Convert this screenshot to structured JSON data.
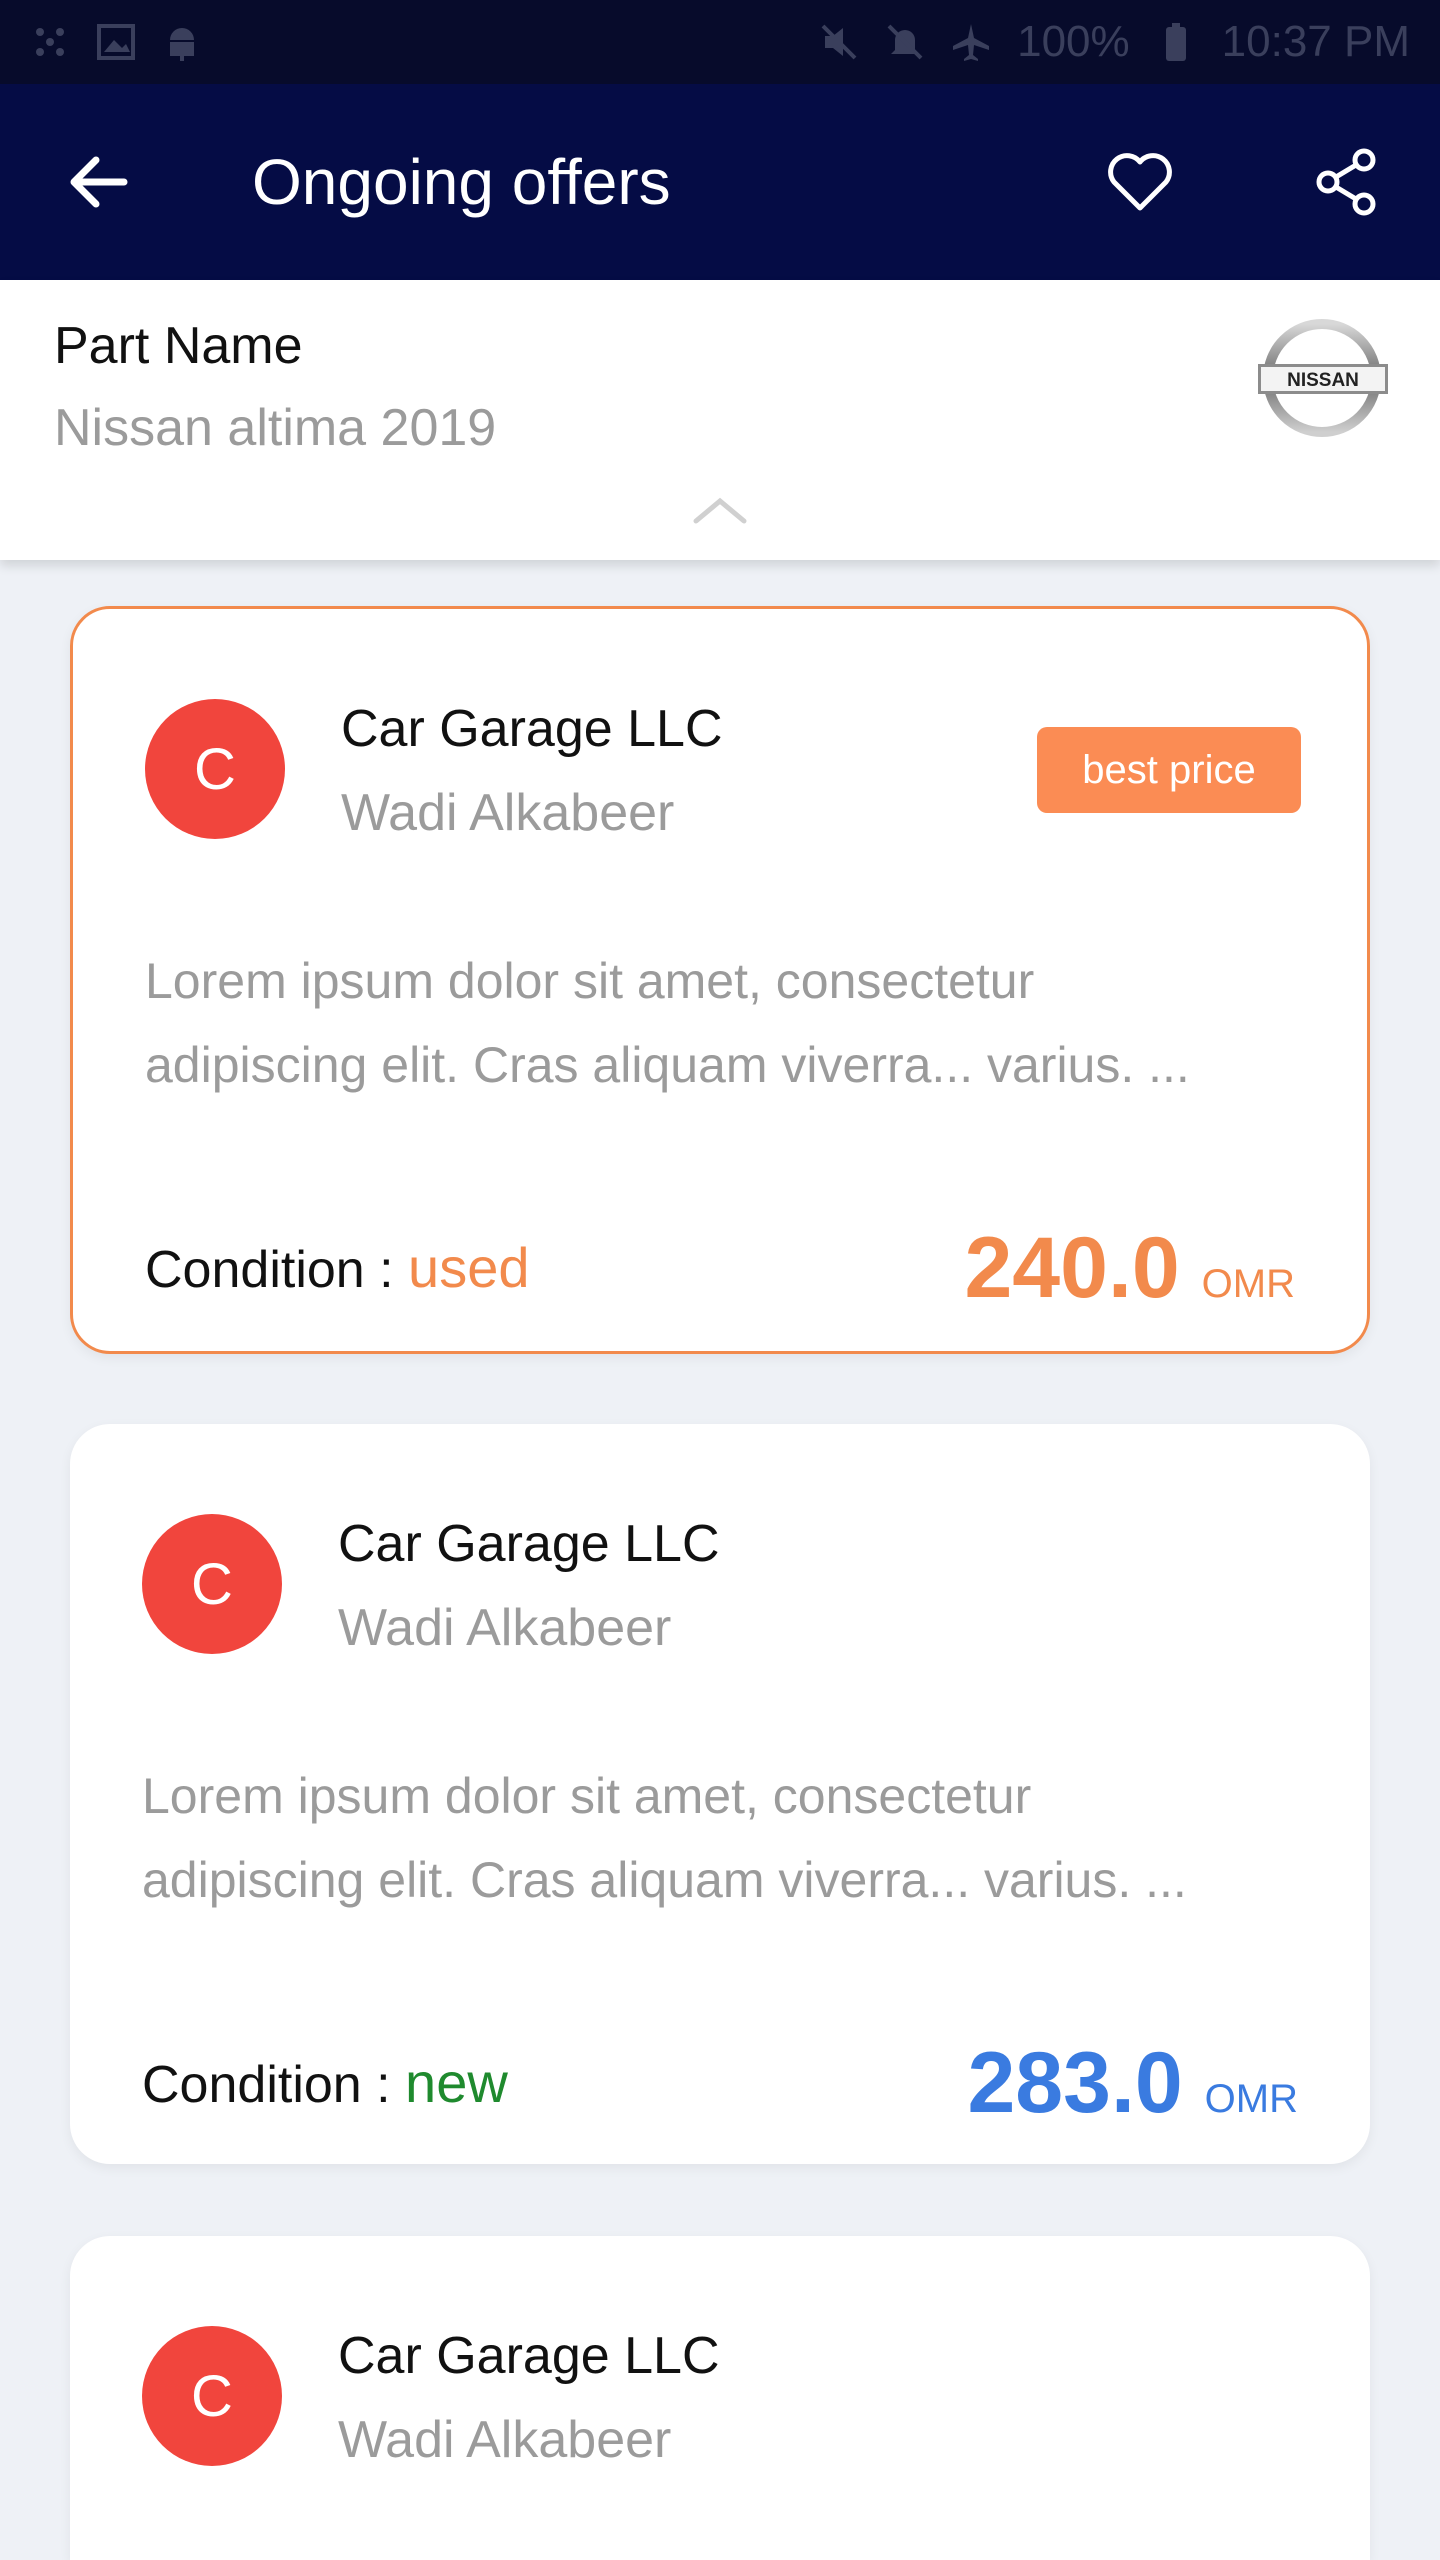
{
  "status_bar": {
    "battery": "100%",
    "time": "10:37 PM"
  },
  "app_bar": {
    "title": "Ongoing offers"
  },
  "part": {
    "label": "Part Name",
    "value": "Nissan altima 2019",
    "brand": "NISSAN"
  },
  "offers": [
    {
      "avatar": "C",
      "seller": "Car Garage LLC",
      "location": "Wadi Alkabeer",
      "badge": "best price",
      "description": "Lorem ipsum dolor sit amet, consectetur adipiscing elit. Cras aliquam viverra... varius. ...",
      "condition_label": "Condition : ",
      "condition": "used",
      "price": "240.0",
      "currency": "OMR"
    },
    {
      "avatar": "C",
      "seller": "Car Garage LLC",
      "location": "Wadi Alkabeer",
      "description": "Lorem ipsum dolor sit amet, consectetur adipiscing elit. Cras aliquam viverra... varius. ...",
      "condition_label": "Condition : ",
      "condition": "new",
      "price": "283.0",
      "currency": "OMR"
    },
    {
      "avatar": "C",
      "seller": "Car Garage LLC",
      "location": "Wadi Alkabeer"
    }
  ],
  "colors": {
    "app_bar": "#050c45",
    "accent_orange": "#f28a4c",
    "price_blue": "#3a7be0",
    "condition_green": "#1f8a2e",
    "avatar_red": "#f1453d"
  },
  "icons": {
    "back": "arrow-left-icon",
    "favorite": "heart-icon",
    "share": "share-icon",
    "collapse": "chevron-up-icon"
  }
}
